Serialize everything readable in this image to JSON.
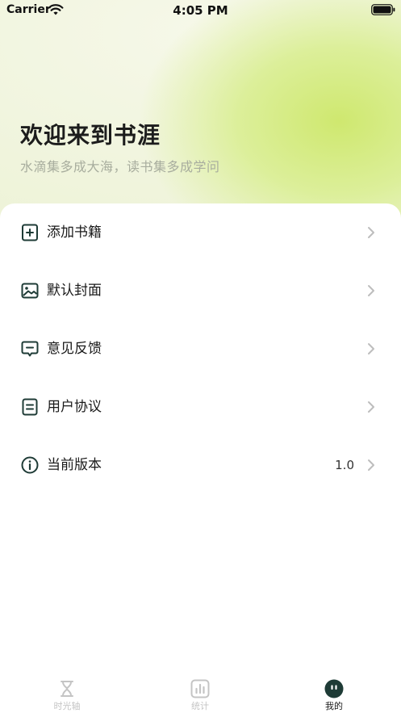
{
  "status_bar": {
    "carrier": "Carrier",
    "time": "4:05 PM"
  },
  "hero": {
    "title": "欢迎来到书涯",
    "subtitle": "水滴集多成大海，读书集多成学问"
  },
  "menu": [
    {
      "label": "添加书籍",
      "icon": "add-book-icon"
    },
    {
      "label": "默认封面",
      "icon": "image-icon"
    },
    {
      "label": "意见反馈",
      "icon": "feedback-icon"
    },
    {
      "label": "用户协议",
      "icon": "document-icon"
    },
    {
      "label": "当前版本",
      "icon": "info-icon",
      "value": "1.0"
    }
  ],
  "tabs": [
    {
      "label": "时光轴",
      "icon": "hourglass-icon",
      "active": false
    },
    {
      "label": "统计",
      "icon": "stats-icon",
      "active": false
    },
    {
      "label": "我的",
      "icon": "profile-icon",
      "active": true
    }
  ],
  "colors": {
    "accent": "#1e3b36",
    "inactive": "#c4c4c4",
    "hero_green": "#cfe86f"
  }
}
